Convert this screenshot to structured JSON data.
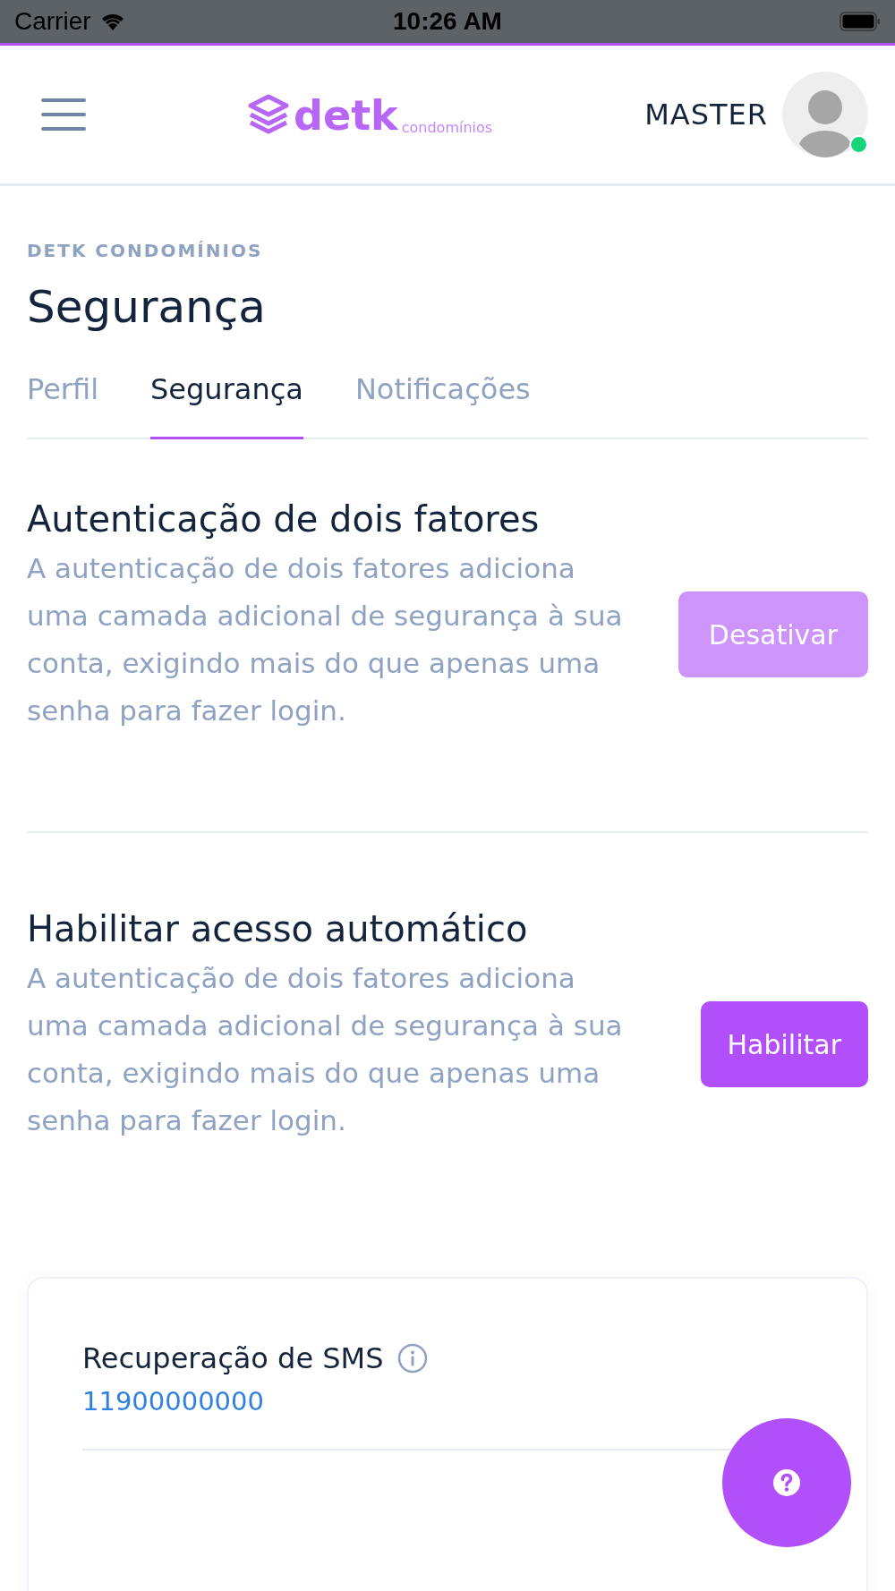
{
  "status_bar": {
    "carrier": "Carrier",
    "time": "10:26 AM"
  },
  "header": {
    "logo_text": "detk",
    "logo_subtext": "condomínios",
    "user_name": "MASTER",
    "online": true
  },
  "breadcrumb": "DETK CONDOMÍNIOS",
  "page_title": "Segurança",
  "tabs": [
    {
      "label": "Perfil",
      "selected": false
    },
    {
      "label": "Segurança",
      "selected": true
    },
    {
      "label": "Notificações",
      "selected": false
    }
  ],
  "sections": [
    {
      "title": "Autenticação de dois fatores",
      "description": "A autenticação de dois fatores adiciona uma camada adicional de segurança à sua conta, exigindo mais do que apenas uma senha para fazer login.",
      "button": {
        "label": "Desativar",
        "disabled": true
      }
    },
    {
      "title": "Habilitar acesso automático",
      "description": "A autenticação de dois fatores adiciona uma camada adicional de segurança à sua conta, exigindo mais do que apenas uma senha para fazer login.",
      "button": {
        "label": "Habilitar",
        "disabled": false
      }
    }
  ],
  "sms_card": {
    "title": "Recuperação de SMS",
    "phone": "11900000000"
  }
}
